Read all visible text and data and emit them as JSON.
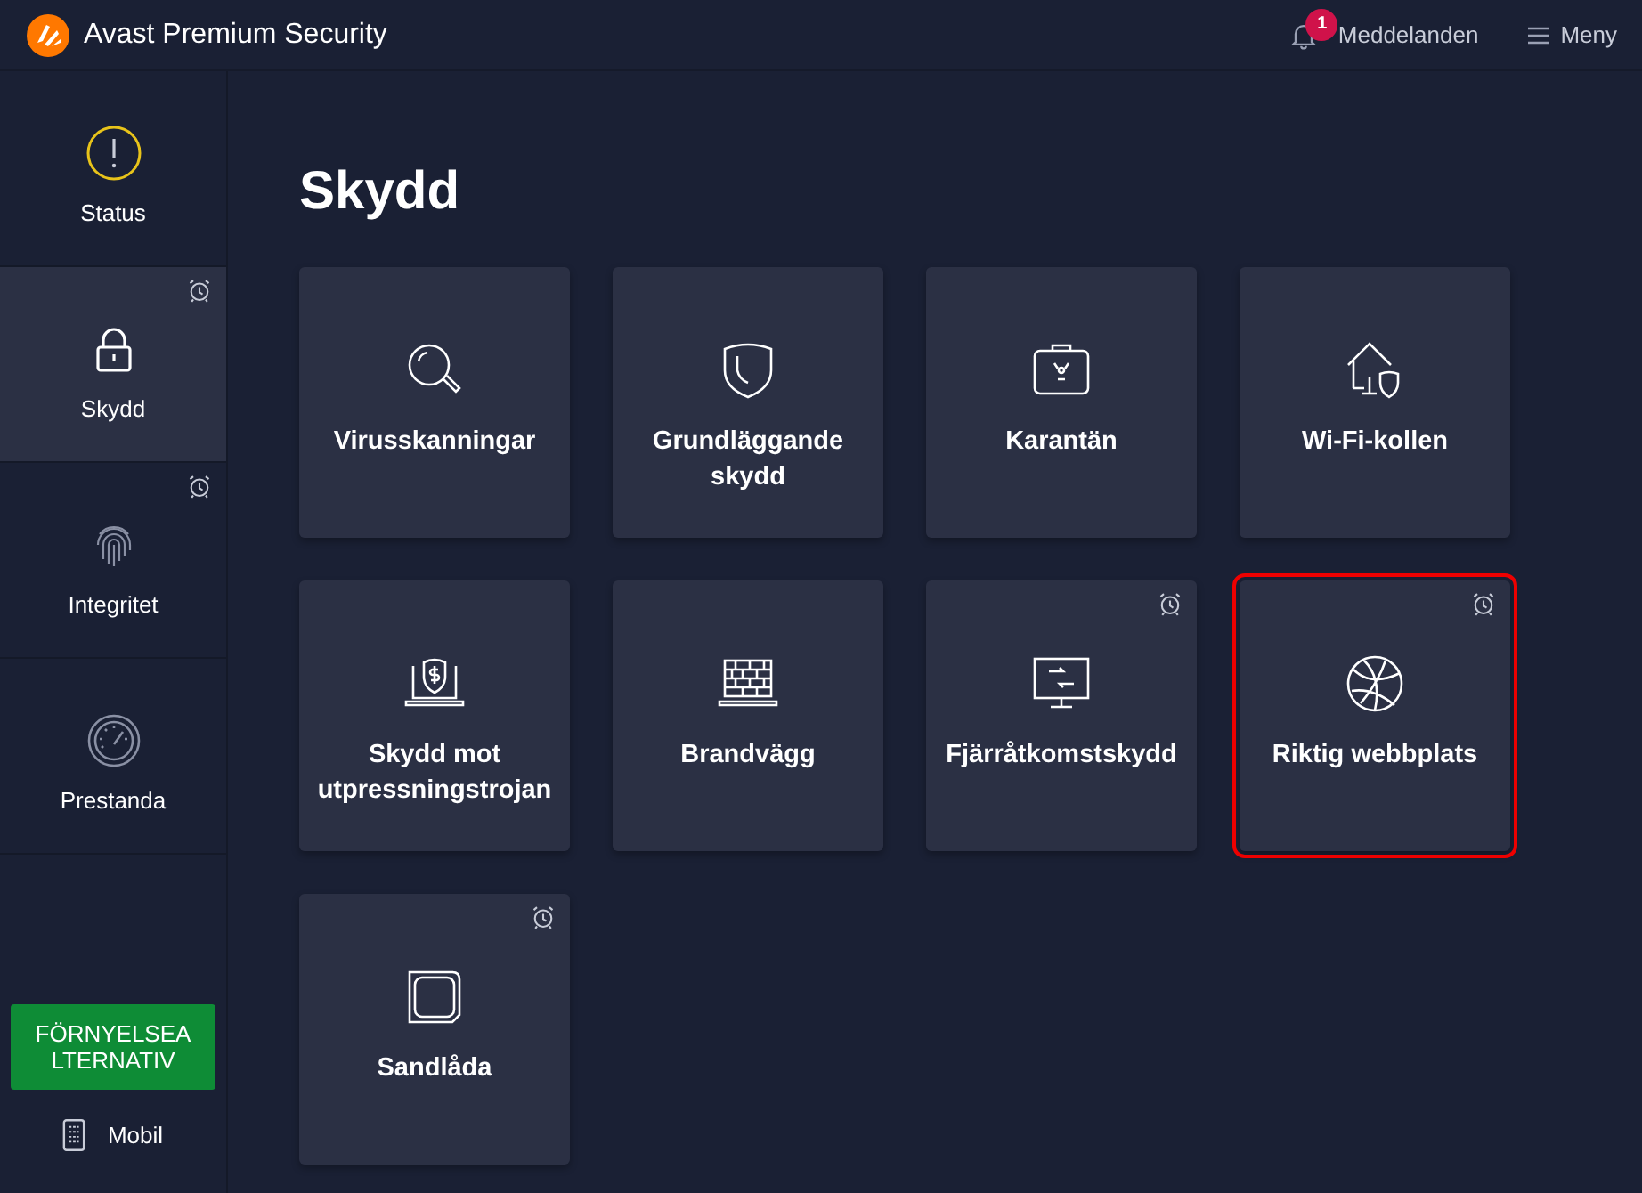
{
  "app": {
    "title": "Avast Premium Security"
  },
  "header": {
    "notifications": {
      "label": "Meddelanden",
      "count": "1"
    },
    "menu": {
      "label": "Meny"
    }
  },
  "sidebar": {
    "items": [
      {
        "label": "Status",
        "kind": "status",
        "selected": false,
        "alarm": false
      },
      {
        "label": "Skydd",
        "kind": "lock",
        "selected": true,
        "alarm": true
      },
      {
        "label": "Integritet",
        "kind": "fingerprint",
        "selected": false,
        "alarm": true
      },
      {
        "label": "Prestanda",
        "kind": "gauge",
        "selected": false,
        "alarm": false
      }
    ],
    "renew_button": "FÖRNYELSEA LTERNATIV",
    "mobile": "Mobil"
  },
  "page": {
    "heading": "Skydd",
    "tiles": [
      {
        "label": "Virusskanningar",
        "kind": "search",
        "alarm": false,
        "highlighted": false
      },
      {
        "label": "Grundläggande skydd",
        "kind": "shield",
        "alarm": false,
        "highlighted": false
      },
      {
        "label": "Karantän",
        "kind": "quarantine",
        "alarm": false,
        "highlighted": false
      },
      {
        "label": "Wi-Fi-kollen",
        "kind": "home",
        "alarm": false,
        "highlighted": false
      },
      {
        "label": "Skydd mot utpressningstrojan",
        "kind": "ransomware",
        "alarm": false,
        "highlighted": false
      },
      {
        "label": "Brandvägg",
        "kind": "firewall",
        "alarm": false,
        "highlighted": false
      },
      {
        "label": "Fjärråtkomstskydd",
        "kind": "remote",
        "alarm": true,
        "highlighted": false
      },
      {
        "label": "Riktig webbplats",
        "kind": "globe",
        "alarm": true,
        "highlighted": true
      },
      {
        "label": "Sandlåda",
        "kind": "sandbox",
        "alarm": true,
        "highlighted": false
      }
    ]
  }
}
